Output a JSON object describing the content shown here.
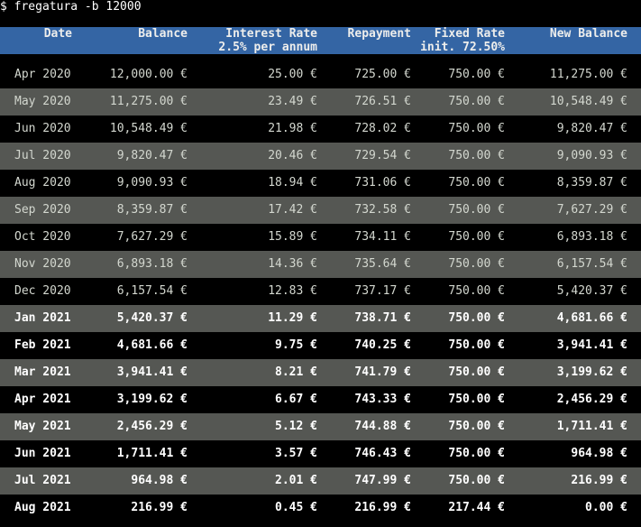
{
  "terminal": {
    "command": "$ fregatura -b 12000"
  },
  "table": {
    "headers": {
      "date": "Date",
      "balance": "Balance",
      "interest": "Interest Rate",
      "interest_sub": "2.5% per annum",
      "repayment": "Repayment",
      "fixed": "Fixed Rate",
      "fixed_sub": "init. 72.50%",
      "new_balance": "New Balance"
    },
    "rows": [
      {
        "date": "Apr 2020",
        "balance": "12,000.00 €",
        "interest": "25.00 €",
        "repayment": "725.00 €",
        "fixed": "750.00 €",
        "new_balance": "11,275.00 €"
      },
      {
        "date": "May 2020",
        "balance": "11,275.00 €",
        "interest": "23.49 €",
        "repayment": "726.51 €",
        "fixed": "750.00 €",
        "new_balance": "10,548.49 €"
      },
      {
        "date": "Jun 2020",
        "balance": "10,548.49 €",
        "interest": "21.98 €",
        "repayment": "728.02 €",
        "fixed": "750.00 €",
        "new_balance": "9,820.47 €"
      },
      {
        "date": "Jul 2020",
        "balance": "9,820.47 €",
        "interest": "20.46 €",
        "repayment": "729.54 €",
        "fixed": "750.00 €",
        "new_balance": "9,090.93 €"
      },
      {
        "date": "Aug 2020",
        "balance": "9,090.93 €",
        "interest": "18.94 €",
        "repayment": "731.06 €",
        "fixed": "750.00 €",
        "new_balance": "8,359.87 €"
      },
      {
        "date": "Sep 2020",
        "balance": "8,359.87 €",
        "interest": "17.42 €",
        "repayment": "732.58 €",
        "fixed": "750.00 €",
        "new_balance": "7,627.29 €"
      },
      {
        "date": "Oct 2020",
        "balance": "7,627.29 €",
        "interest": "15.89 €",
        "repayment": "734.11 €",
        "fixed": "750.00 €",
        "new_balance": "6,893.18 €"
      },
      {
        "date": "Nov 2020",
        "balance": "6,893.18 €",
        "interest": "14.36 €",
        "repayment": "735.64 €",
        "fixed": "750.00 €",
        "new_balance": "6,157.54 €"
      },
      {
        "date": "Dec 2020",
        "balance": "6,157.54 €",
        "interest": "12.83 €",
        "repayment": "737.17 €",
        "fixed": "750.00 €",
        "new_balance": "5,420.37 €"
      },
      {
        "date": "Jan 2021",
        "balance": "5,420.37 €",
        "interest": "11.29 €",
        "repayment": "738.71 €",
        "fixed": "750.00 €",
        "new_balance": "4,681.66 €"
      },
      {
        "date": "Feb 2021",
        "balance": "4,681.66 €",
        "interest": "9.75 €",
        "repayment": "740.25 €",
        "fixed": "750.00 €",
        "new_balance": "3,941.41 €"
      },
      {
        "date": "Mar 2021",
        "balance": "3,941.41 €",
        "interest": "8.21 €",
        "repayment": "741.79 €",
        "fixed": "750.00 €",
        "new_balance": "3,199.62 €"
      },
      {
        "date": "Apr 2021",
        "balance": "3,199.62 €",
        "interest": "6.67 €",
        "repayment": "743.33 €",
        "fixed": "750.00 €",
        "new_balance": "2,456.29 €"
      },
      {
        "date": "May 2021",
        "balance": "2,456.29 €",
        "interest": "5.12 €",
        "repayment": "744.88 €",
        "fixed": "750.00 €",
        "new_balance": "1,711.41 €"
      },
      {
        "date": "Jun 2021",
        "balance": "1,711.41 €",
        "interest": "3.57 €",
        "repayment": "746.43 €",
        "fixed": "750.00 €",
        "new_balance": "964.98 €"
      },
      {
        "date": "Jul 2021",
        "balance": "964.98 €",
        "interest": "2.01 €",
        "repayment": "747.99 €",
        "fixed": "750.00 €",
        "new_balance": "216.99 €"
      },
      {
        "date": "Aug 2021",
        "balance": "216.99 €",
        "interest": "0.45 €",
        "repayment": "216.99 €",
        "fixed": "217.44 €",
        "new_balance": "0.00 €"
      }
    ]
  },
  "colors": {
    "background": "#000000",
    "header_background": "#3465a4",
    "alt_row_background": "#555753",
    "text": "#d3d7cf",
    "bold_text": "#ffffff"
  }
}
